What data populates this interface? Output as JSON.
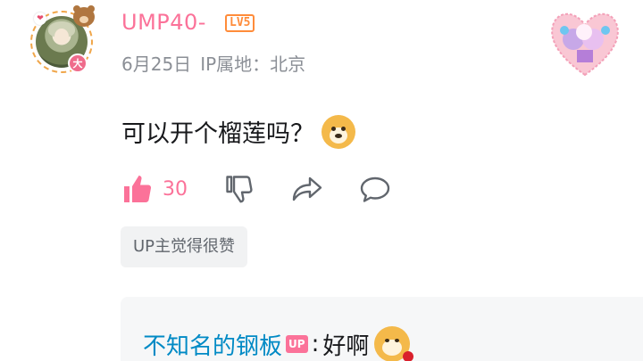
{
  "comment": {
    "username": "UMP40-",
    "level": "LV5",
    "date": "6月25日",
    "ip_location": "IP属地：北京",
    "text": "可以开个榴莲吗？",
    "like_count": "30",
    "badge_char": "大",
    "up_tag": "UP主觉得很赞"
  },
  "reply": {
    "name": "不知名的钢板",
    "up_badge": "UP",
    "separator": ":",
    "text": "好啊"
  },
  "colors": {
    "username": "#fb7299",
    "level": "#ff8c3a",
    "reply_name": "#008ac5",
    "meta": "#8b8f96"
  },
  "icons": [
    "heart-icon",
    "bear-icon",
    "like-icon",
    "dislike-icon",
    "share-icon",
    "reply-icon",
    "doge-emoji",
    "doge-rose-emoji"
  ]
}
